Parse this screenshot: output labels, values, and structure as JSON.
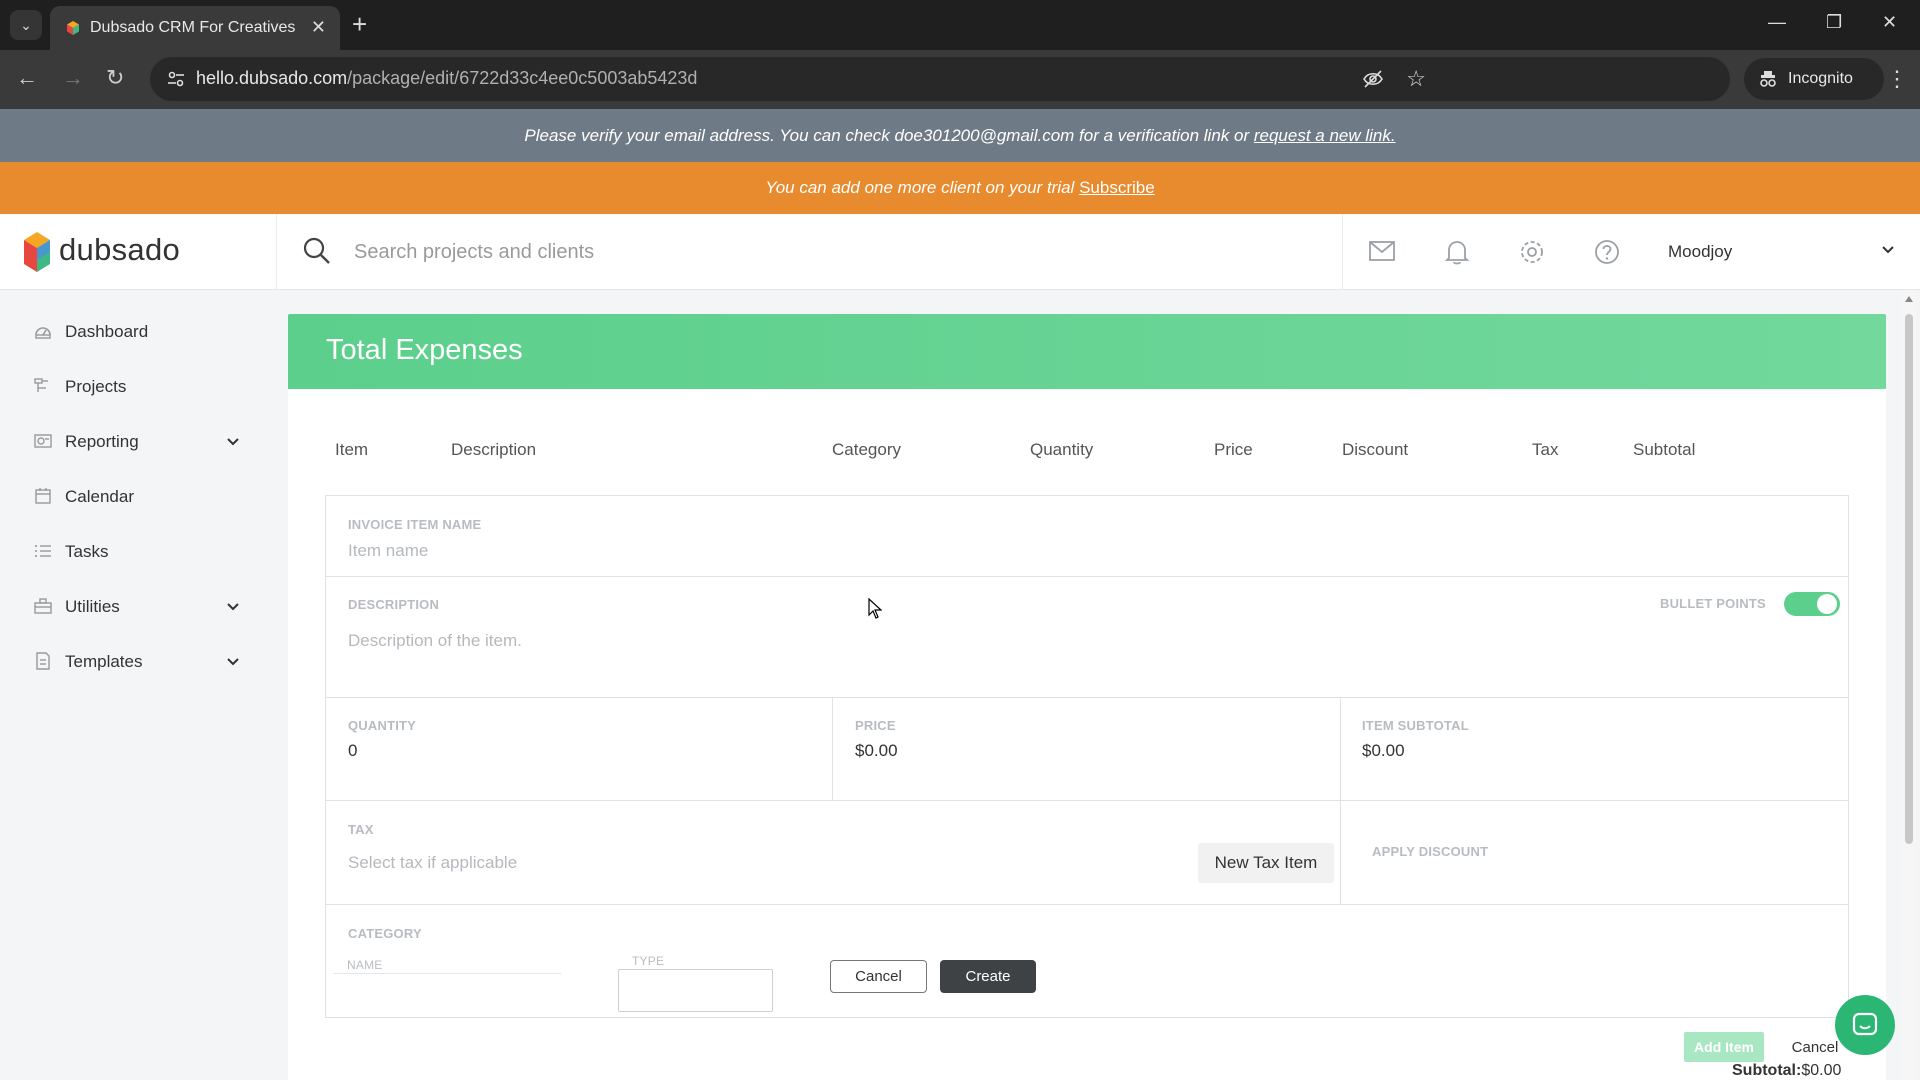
{
  "browser": {
    "tab_title": "Dubsado CRM For Creatives",
    "url_host": "hello.dubsado.com",
    "url_path": "/package/edit/6722d33c4ee0c5003ab5423d",
    "incognito_label": "Incognito"
  },
  "banners": {
    "verify_text": "Please verify your email address. You can check doe301200@gmail.com for a verification link or",
    "verify_link": "request a new link.",
    "trial_text": "You can add one more client on your trial",
    "trial_link": "Subscribe"
  },
  "header": {
    "logo_text": "dubsado",
    "search_placeholder": "Search projects and clients",
    "user_name": "Moodjoy"
  },
  "sidebar": {
    "items": [
      {
        "label": "Dashboard",
        "icon": "dashboard-icon"
      },
      {
        "label": "Projects",
        "icon": "projects-icon"
      },
      {
        "label": "Reporting",
        "icon": "reporting-icon"
      },
      {
        "label": "Calendar",
        "icon": "calendar-icon"
      },
      {
        "label": "Tasks",
        "icon": "tasks-icon"
      },
      {
        "label": "Utilities",
        "icon": "utilities-icon"
      },
      {
        "label": "Templates",
        "icon": "templates-icon"
      }
    ]
  },
  "main": {
    "title": "Total Expenses",
    "columns": [
      "Item",
      "Description",
      "Category",
      "Quantity",
      "Price",
      "Discount",
      "Tax",
      "Subtotal"
    ],
    "form": {
      "item_name_label": "INVOICE ITEM NAME",
      "item_name_placeholder": "Item name",
      "description_label": "DESCRIPTION",
      "description_placeholder": "Description of the item.",
      "bullet_points_label": "BULLET POINTS",
      "bullet_points_on": true,
      "quantity_label": "QUANTITY",
      "quantity_value": "0",
      "price_label": "PRICE",
      "price_value": "$0.00",
      "item_subtotal_label": "ITEM SUBTOTAL",
      "item_subtotal_value": "$0.00",
      "tax_label": "TAX",
      "tax_placeholder": "Select tax if applicable",
      "new_tax_button": "New Tax Item",
      "apply_discount_label": "APPLY DISCOUNT",
      "category_label": "CATEGORY",
      "category_name_label": "NAME",
      "category_type_label": "TYPE",
      "cancel_button": "Cancel",
      "create_button": "Create"
    },
    "add_item_button": "Add Item",
    "cancel_button": "Cancel",
    "subtotal_label": "Subtotal:",
    "subtotal_value": "$0.00"
  },
  "colors": {
    "accent_green": "#5ccf8c",
    "trial_orange": "#e88a2e",
    "verify_gray": "#6e7a86"
  }
}
